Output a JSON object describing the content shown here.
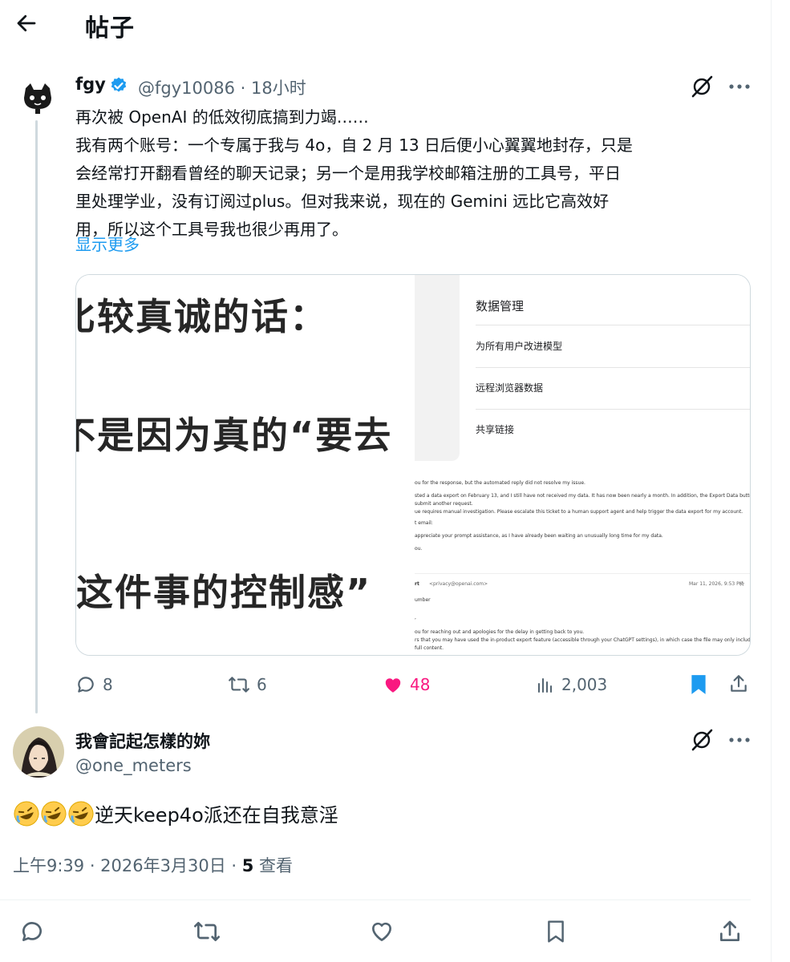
{
  "header": {
    "title": "帖子"
  },
  "quoted_post": {
    "name": "fgy",
    "handle": "@fgy10086",
    "time": "18小时",
    "lines": [
      "再次被 OpenAI 的低效彻底搞到力竭……",
      "我有两个账号：一个专属于我与 4o，自 2 月 13 日后便小心翼翼地封存，只是",
      "会经常打开翻看曾经的聊天记录；另一个是用我学校邮箱注册的工具号，平日",
      "里处理学业，没有订阅过plus。但对我来说，现在的 Gemini 远比它高效好",
      "用，所以这个工具号我也很少再用了。"
    ],
    "show_more": "显示更多",
    "media": {
      "left_lines": [
        "比较真诚的话：",
        "不是因为真的“要去",
        "这件事的控制感”"
      ],
      "right_menu": [
        "数据管理",
        "为所有用户改进模型",
        "远程浏览器数据",
        "共享链接"
      ],
      "email_lines": [
        "ou for the response, but the automated reply did not resolve my issue.",
        "sted a data export on February 13, and I still have not received my data. It has now been nearly a month. In addition, the Export Data button in my account is un",
        "submit another request.",
        "ue requires manual investigation. Please escalate this ticket to a human support agent and help trigger the data export for my account.",
        "t email:",
        "appreciate your prompt assistance, as I have already been waiting an unusually long time for my data.",
        "ou.",
        "rt",
        "<privacy@openai.com>",
        "Mar 11, 2026, 9:53 PM",
        "umber",
        ",",
        "ou for reaching out and apologies for the delay in getting back to you.",
        "rs that you may have used the in-product export feature (accessible through your ChatGPT settings), in which case the file may only include references to your con",
        "full content."
      ]
    },
    "stats": {
      "replies": "8",
      "reposts": "6",
      "likes": "48",
      "views": "2,003"
    }
  },
  "reply": {
    "name": "我會記起怎樣的妳",
    "handle": "@one_meters",
    "text": "逆天keep4o派还在自我意淫",
    "timestamp": "上午9:39 · 2026年3月30日 · ",
    "views_count": "5",
    "views_label": " 查看"
  },
  "colors": {
    "accent": "#1d9bf0",
    "like": "#f91880",
    "muted": "#536471",
    "text": "#0f1419"
  },
  "icons": [
    "back-arrow-icon",
    "verified-badge-icon",
    "grok-icon",
    "more-icon",
    "reply-icon",
    "repost-icon",
    "heart-icon",
    "views-icon",
    "bookmark-icon",
    "share-icon",
    "rofl-emoji-icon"
  ]
}
